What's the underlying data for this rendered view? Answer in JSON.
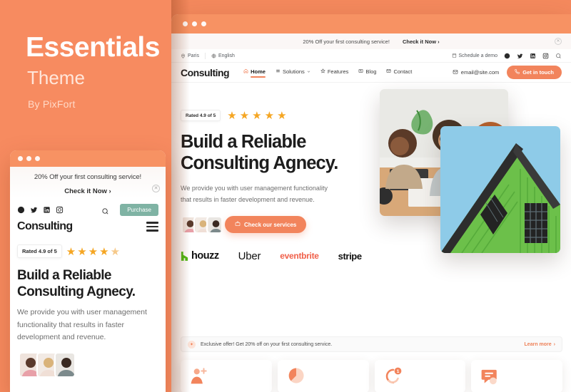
{
  "theme": {
    "accent": "#F2845C",
    "background": "#F58A5E",
    "star_color": "#F5A623",
    "purchase_green": "#7FB3A4"
  },
  "promo": {
    "title": "Essentials",
    "subtitle": "Theme",
    "byline": "By PixFort"
  },
  "mobile": {
    "banner_text": "20% Off your first consulting service!",
    "banner_cta": "Check it Now ›",
    "close_icon": "close-icon",
    "social_icons": [
      "facebook-icon",
      "twitter-icon",
      "linkedin-icon",
      "instagram-icon"
    ],
    "search_icon": "search-icon",
    "purchase_label": "Purchase",
    "brand": "Consulting",
    "menu_icon": "hamburger-menu-icon",
    "rated_label": "Rated 4.9 of 5",
    "stars": 5,
    "heading_line1": "Build a Reliable",
    "heading_line2": "Consulting Agnecy.",
    "paragraph": "We provide you with user management functionality that results in faster development and revenue."
  },
  "desktop": {
    "promo_bar": {
      "text": "20% Off your first consulting service!",
      "cta": "Check it Now ›",
      "close_icon": "close-icon"
    },
    "utility_bar": {
      "location": "Paris",
      "location_icon": "location-pin-icon",
      "language": "English",
      "language_icon": "globe-icon",
      "schedule": "Schedule a demo",
      "schedule_icon": "calendar-icon",
      "social_icons": [
        "facebook-icon",
        "twitter-icon",
        "linkedin-icon",
        "instagram-icon"
      ],
      "search_icon": "search-icon"
    },
    "nav": {
      "brand": "Consulting",
      "items": [
        {
          "label": "Home",
          "icon": "home-icon",
          "active": true,
          "has_caret": false
        },
        {
          "label": "Solutions",
          "icon": "grid-icon",
          "active": false,
          "has_caret": true
        },
        {
          "label": "Features",
          "icon": "star-outline-icon",
          "active": false,
          "has_caret": false
        },
        {
          "label": "Blog",
          "icon": "news-icon",
          "active": false,
          "has_caret": false
        },
        {
          "label": "Contact",
          "icon": "envelope-icon",
          "active": false,
          "has_caret": false
        }
      ],
      "email": "email@site.com",
      "email_icon": "envelope-icon",
      "cta_label": "Get in touch",
      "cta_icon": "phone-icon"
    },
    "hero": {
      "rated_label": "Rated 4.9 of 5",
      "stars": 5,
      "heading_line1": "Build a Reliable",
      "heading_line2": "Consulting Agnecy.",
      "paragraph_line1": "We provide you with user management functionality",
      "paragraph_line2": "that results in faster development and revenue.",
      "services_label": "Check our services",
      "services_icon": "briefcase-icon",
      "brands": [
        {
          "name": "houzz",
          "icon": "houzz-logo-icon"
        },
        {
          "name": "Uber",
          "icon": "uber-logo-icon"
        },
        {
          "name": "eventbrite",
          "icon": "eventbrite-logo-icon"
        },
        {
          "name": "stripe",
          "icon": "stripe-logo-icon"
        }
      ]
    },
    "offer_strip": {
      "badge_icon": "spark-icon",
      "text": "Exclusive offer! Get 20% off on your first consulting service.",
      "link": "Learn more",
      "link_caret": "›"
    },
    "cards": [
      {
        "icon": "add-user-icon"
      },
      {
        "icon": "pie-chart-icon"
      },
      {
        "icon": "notification-bell-icon",
        "badge": "1"
      },
      {
        "icon": "chat-message-icon"
      }
    ]
  }
}
